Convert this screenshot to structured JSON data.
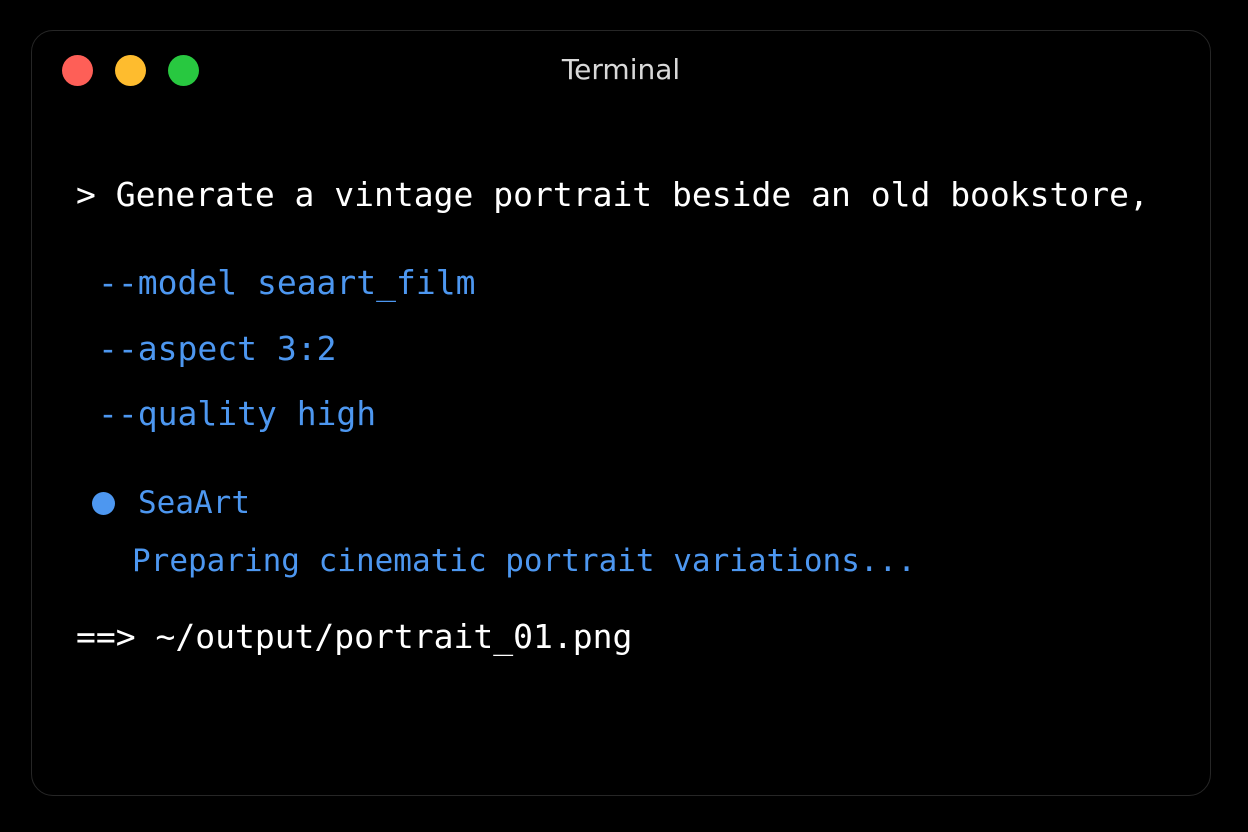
{
  "window": {
    "title": "Terminal"
  },
  "colors": {
    "background": "#000000",
    "close": "#fe5f57",
    "minimize": "#febc2e",
    "zoom": "#28c840",
    "accent": "#4d97f0",
    "text": "#ffffff"
  },
  "terminal": {
    "prompt_symbol": ">",
    "command": "Generate a vintage portrait beside an old bookstore,",
    "flags": [
      {
        "name": "--model",
        "value": "seaart_film"
      },
      {
        "name": "--aspect",
        "value": "3:2"
      },
      {
        "name": "--quality",
        "value": "high"
      }
    ],
    "status": {
      "label": "SeaArt",
      "message": "Preparing cinematic portrait variations..."
    },
    "output": {
      "arrow": "==>",
      "path": "~/output/portrait_01.png"
    }
  }
}
